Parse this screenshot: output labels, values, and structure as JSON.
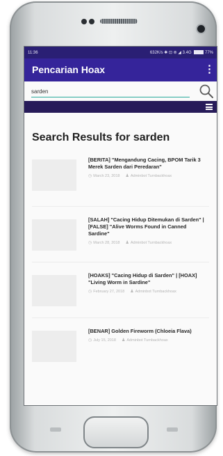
{
  "status_bar": {
    "time": "11:36",
    "indicators": "632K/s ✱ ⊡ ⊚ ◢ 3.4G",
    "battery": "77%"
  },
  "app_bar": {
    "title": "Pencarian Hoax",
    "menu_icon": "more-vert-icon"
  },
  "search": {
    "value": "sarden",
    "icon": "search-icon"
  },
  "nav": {
    "icon": "hamburger-menu-icon"
  },
  "results_title": "Search Results for sarden",
  "results": [
    {
      "title": "[BERITA] \"Mengandung Cacing, BPOM Tarik 3 Merek Sarden dari Peredaran\"",
      "date": "March 23, 2018",
      "author": "Adminbot Turnbackhoax"
    },
    {
      "title": "[SALAH] \"Cacing Hidup Ditemukan di Sarden\" | [FALSE] \"Alive Worms Found in Canned Sardine\"",
      "date": "March 28, 2018",
      "author": "Adminbot Turnbackhoax"
    },
    {
      "title": "[HOAKS] \"Cacing Hidup di Sarden\" | [HOAX] \"Living Worm in Sardine\"",
      "date": "February 27, 2018",
      "author": "Adminbot Turnbackhoax"
    },
    {
      "title": "[BENAR] Golden Fireworm (Chloeia Flava)",
      "date": "July 15, 2018",
      "author": "Adminbot Turnbackhoax"
    }
  ],
  "colors": {
    "app_bar": "#35249a",
    "status_bar": "#2a1f74",
    "nav_bar": "#271b59",
    "accent": "#28a99c"
  }
}
